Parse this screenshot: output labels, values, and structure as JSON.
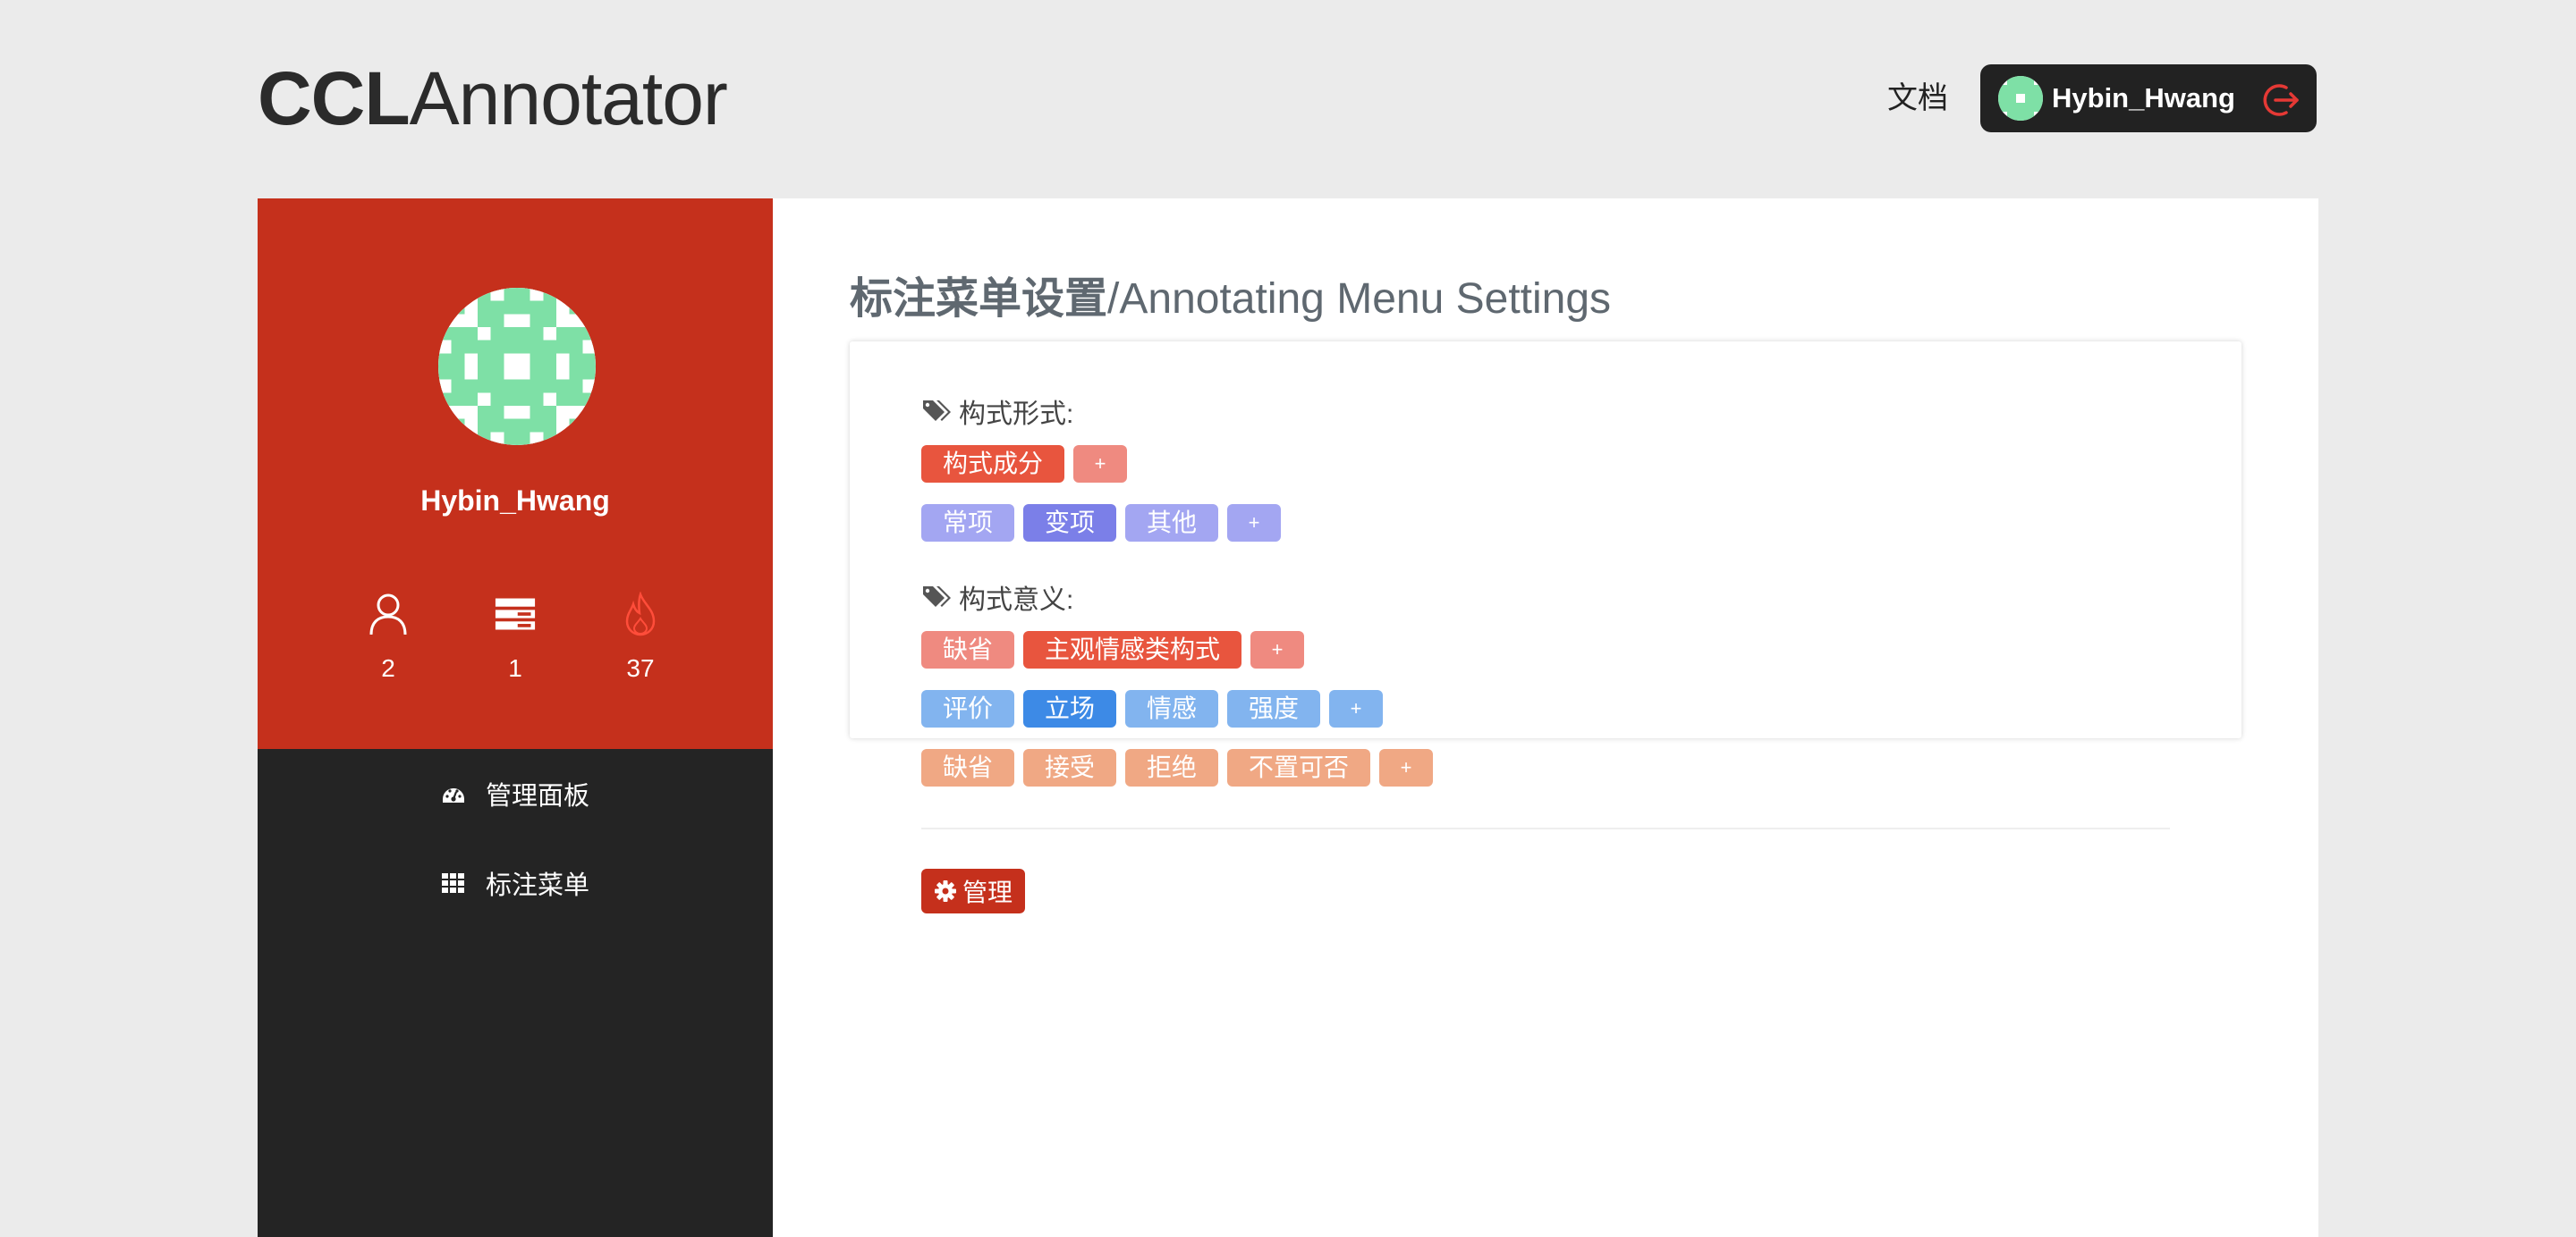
{
  "header": {
    "logo_bold": "CCL",
    "logo_light": "Annotator",
    "docs_link": "文档",
    "user_name": "Hybin_Hwang"
  },
  "sidebar": {
    "username": "Hybin_Hwang",
    "stats": [
      {
        "icon": "user-icon",
        "value": "2"
      },
      {
        "icon": "server-icon",
        "value": "1"
      },
      {
        "icon": "fire-icon",
        "value": "37"
      }
    ],
    "nav": [
      {
        "icon": "dashboard-icon",
        "label": "管理面板"
      },
      {
        "icon": "grid-icon",
        "label": "标注菜单"
      }
    ]
  },
  "main": {
    "title_cn": "标注菜单设置",
    "title_en": "/Annotating Menu Settings",
    "sections": [
      {
        "label": "构式形式:",
        "rows": [
          {
            "tags": [
              "构式成分"
            ],
            "plus": "+"
          },
          {
            "tags": [
              "常项",
              "变项",
              "其他"
            ],
            "plus": "+"
          }
        ]
      },
      {
        "label": "构式意义:",
        "rows": [
          {
            "tags": [
              "缺省",
              "主观情感类构式"
            ],
            "plus": "+"
          },
          {
            "tags": [
              "评价",
              "立场",
              "情感",
              "强度"
            ],
            "plus": "+"
          },
          {
            "tags": [
              "缺省",
              "接受",
              "拒绝",
              "不置可否"
            ],
            "plus": "+"
          }
        ]
      }
    ],
    "manage_button": "管理"
  },
  "colors": {
    "brand_red": "#c5301c",
    "sidebar_dark": "#242424",
    "tag_red": "#e8553e",
    "tag_red_light": "#ef8a80",
    "tag_purple": "#7b7fe8",
    "tag_purple_light": "#a3a6f2",
    "tag_blue": "#3d8ae6",
    "tag_blue_light": "#82b4ef",
    "tag_orange": "#f0a884"
  }
}
